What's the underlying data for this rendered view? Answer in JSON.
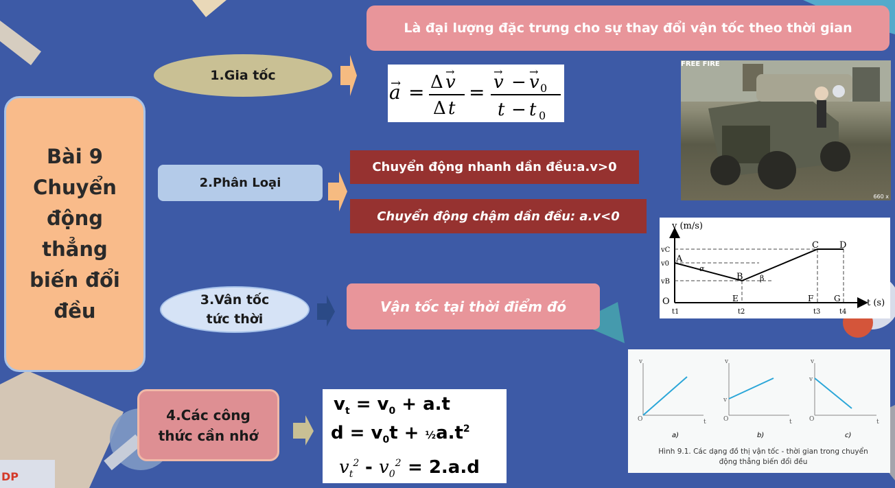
{
  "title": "Bài 9\nChuyển\nđộng\nthẳng\nbiến đổi\nđều",
  "definition": "Là đại lượng đặc trưng cho sự thay đổi vận tốc theo thời gian",
  "sections": {
    "s1": {
      "label": "1.Gia tốc"
    },
    "s2": {
      "label": "2.Phân Loại",
      "fast": "Chuyển động nhanh dần đều:a.v>0",
      "slow": "Chuyển động chậm dần đều: a.v<0"
    },
    "s3": {
      "label": "3.Vân tốc\ntức thời",
      "desc": "Vận tốc tại thời điểm đó"
    },
    "s4": {
      "label": "4.Các công\nthức cần nhớ"
    }
  },
  "formulas": {
    "accel": "a⃗ = Δv⃗ / Δt = (v⃗ − v⃗₀) / (t − t₀)",
    "f1": "vt = v0 + a.t",
    "f2": "d = v0t + ½a.t²",
    "f3": "vt² - v0² = 2.a.d"
  },
  "graph1": {
    "ylabel": "v (m/s)",
    "xlabel": "t (s)",
    "points": [
      "A",
      "B",
      "C",
      "D",
      "E",
      "F",
      "G",
      "O"
    ],
    "yticks": [
      "vC",
      "v0",
      "vB"
    ],
    "xticks": [
      "t1",
      "t2",
      "t3",
      "t4"
    ],
    "angles": [
      "α",
      "β"
    ]
  },
  "graph2": {
    "caption": "Hình 9.1. Các dạng đồ thị vận tốc - thời gian trong chuyển động thẳng biến đổi đều",
    "panels": [
      "a)",
      "b)",
      "c)"
    ]
  },
  "photo": {
    "overlay": "FREE FIRE",
    "corner": "660 x"
  },
  "colors": {
    "background": "#3d5aa6",
    "title_box": "#f9bb8a",
    "red_bar": "#963230",
    "pink": "#e8959a"
  }
}
